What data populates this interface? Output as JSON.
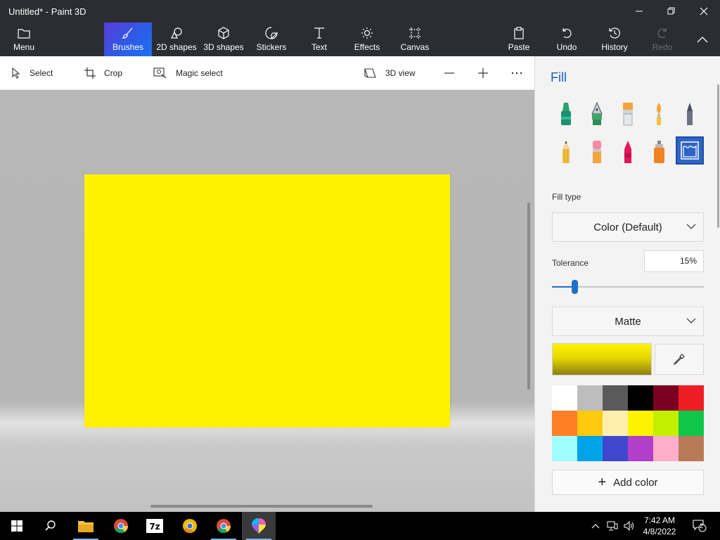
{
  "window": {
    "title": "Untitled* - Paint 3D",
    "minimize_icon": "minimize-icon",
    "restore_icon": "restore-icon",
    "close_icon": "close-icon"
  },
  "ribbon": {
    "menu": "Menu",
    "brushes": "Brushes",
    "shapes2d": "2D shapes",
    "shapes3d": "3D shapes",
    "stickers": "Stickers",
    "text": "Text",
    "effects": "Effects",
    "canvas": "Canvas",
    "paste": "Paste",
    "undo": "Undo",
    "history": "History",
    "redo": "Redo"
  },
  "commandbar": {
    "select": "Select",
    "crop": "Crop",
    "magic_select": "Magic select",
    "view3d": "3D view"
  },
  "canvas": {
    "fill_color": "#fff200"
  },
  "panel": {
    "title": "Fill",
    "fill_type_label": "Fill type",
    "fill_type_value": "Color (Default)",
    "tolerance_label": "Tolerance",
    "tolerance_value": "15%",
    "tolerance_fraction": 0.15,
    "finish_value": "Matte",
    "add_color": "Add color",
    "brushes": [
      "marker",
      "calligraphy-pen",
      "oil-brush",
      "watercolor",
      "pixel-pen",
      "pencil",
      "eraser",
      "crayon",
      "spray-can",
      "fill"
    ],
    "selected_brush": "fill",
    "palette": [
      "#ffffff",
      "#bdbdbd",
      "#5a5a5a",
      "#000000",
      "#7a0021",
      "#ee1d24",
      "#ff7f27",
      "#ffc90e",
      "#ffefaf",
      "#fff200",
      "#c0f000",
      "#0fc64a",
      "#9ffdfd",
      "#00a3e8",
      "#3f48cc",
      "#b13fca",
      "#ffaec9",
      "#b97a57"
    ]
  },
  "taskbar": {
    "time": "7:42 AM",
    "date": "4/8/2022",
    "notifications": "2"
  }
}
